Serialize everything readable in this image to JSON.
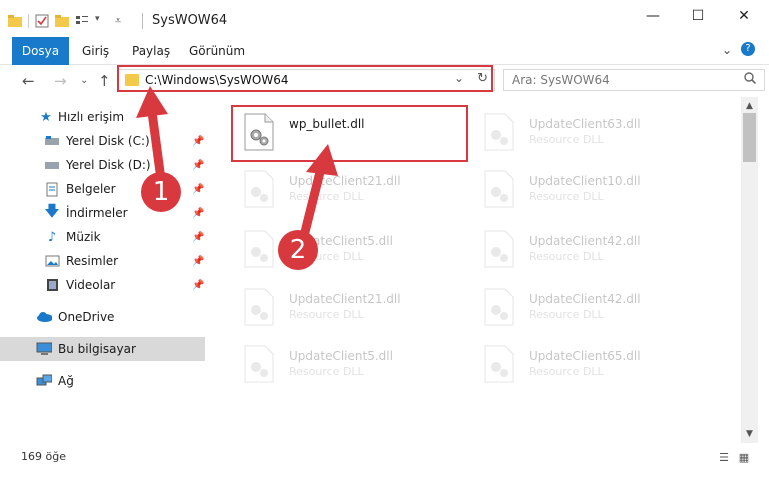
{
  "window": {
    "title": "SysWOW64",
    "minimize": "—",
    "maximize": "☐",
    "close": "✕"
  },
  "ribbon": {
    "tabs": [
      "Dosya",
      "Giriş",
      "Paylaş",
      "Görünüm"
    ],
    "expand": "⌄",
    "help": "?"
  },
  "nav": {
    "back": "←",
    "forward": "→",
    "recent": "⌄",
    "up": "↑",
    "address": "C:\\Windows\\SysWOW64",
    "address_chevron": "⌄",
    "refresh": "↻",
    "search_placeholder": "Ara: SysWOW64",
    "search_icon": "🔍"
  },
  "sidebar": {
    "items": [
      {
        "label": "Hızlı erişim",
        "icon": "star-icon"
      },
      {
        "label": "Yerel Disk (C:)",
        "icon": "drive-icon"
      },
      {
        "label": "Yerel Disk (D:)",
        "icon": "drive-icon"
      },
      {
        "label": "Belgeler",
        "icon": "documents-icon"
      },
      {
        "label": "İndirmeler",
        "icon": "download-icon"
      },
      {
        "label": "Müzik",
        "icon": "music-icon"
      },
      {
        "label": "Resimler",
        "icon": "pictures-icon"
      },
      {
        "label": "Videolar",
        "icon": "video-icon"
      },
      {
        "label": "OneDrive",
        "icon": "cloud-icon"
      },
      {
        "label": "Bu bilgisayar",
        "icon": "computer-icon"
      },
      {
        "label": "Ağ",
        "icon": "network-icon"
      }
    ],
    "pin_glyph": "📌"
  },
  "files": {
    "highlighted": {
      "name": "wp_bullet.dll",
      "type": ""
    },
    "items": [
      {
        "name": "UpdateClient63.dll",
        "type": "Resource DLL"
      },
      {
        "name": "UpdateClient21.dll",
        "type": "Resource DLL"
      },
      {
        "name": "UpdateClient10.dll",
        "type": "Resource DLL"
      },
      {
        "name": "UpdateClient5.dll",
        "type": "Resource DLL"
      },
      {
        "name": "UpdateClient42.dll",
        "type": "Resource DLL"
      },
      {
        "name": "UpdateClient21.dll",
        "type": "Resource DLL"
      },
      {
        "name": "UpdateClient42.dll",
        "type": "Resource DLL"
      },
      {
        "name": "UpdateClient5.dll",
        "type": "Resource DLL"
      },
      {
        "name": "UpdateClient65.dll",
        "type": "Resource DLL"
      }
    ]
  },
  "status": {
    "count": "169 öğe"
  },
  "annotations": {
    "step1": "1",
    "step2": "2",
    "color": "#d8393e"
  },
  "colors": {
    "accent": "#1979ca",
    "folder": "#f3c94b",
    "highlight": "#d8393e"
  }
}
